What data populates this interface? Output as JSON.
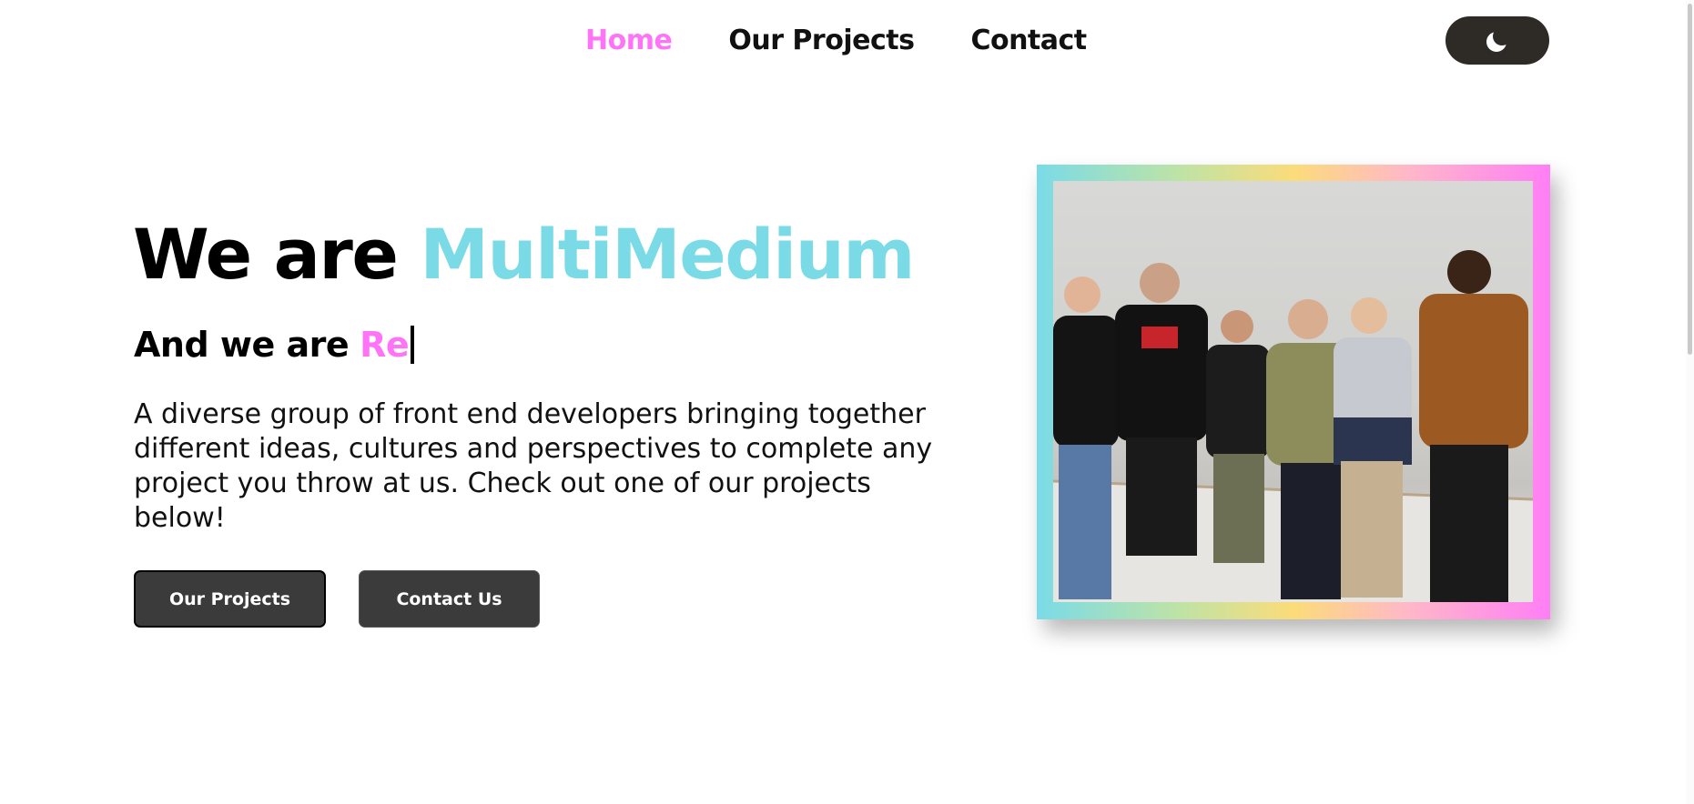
{
  "nav": {
    "links": [
      {
        "label": "Home",
        "active": true
      },
      {
        "label": "Our Projects",
        "active": false
      },
      {
        "label": "Contact",
        "active": false
      }
    ],
    "theme_toggle_icon": "moon-icon"
  },
  "hero": {
    "title_prefix": "We are",
    "title_brand": "MultiMedium",
    "subtitle_prefix": "And we are",
    "subtitle_typed": "Re",
    "description": "A diverse group of front end developers bringing together different ideas, cultures and perspectives to complete any project you throw at us. Check out one of our projects below!",
    "buttons": {
      "projects_label": "Our Projects",
      "contact_label": "Contact Us"
    },
    "photo": {
      "description_icon": "team-photo"
    }
  },
  "colors": {
    "accent_pink": "#ff73f7",
    "accent_cyan": "#7adbe7",
    "button_bg": "#3b3b3b",
    "toggle_bg": "#2e2b27"
  }
}
